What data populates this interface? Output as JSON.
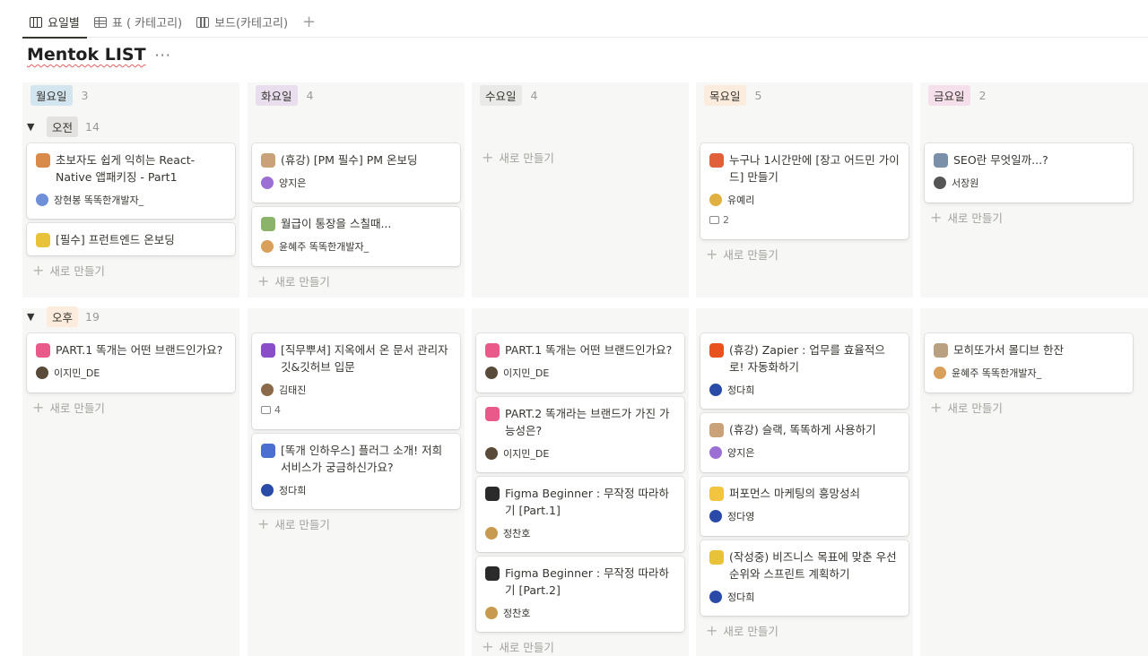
{
  "tabs": [
    {
      "label": "요일별",
      "icon": "board-view-icon"
    },
    {
      "label": "표 ( 카테고리)",
      "icon": "table-view-icon"
    },
    {
      "label": "보드(카테고리)",
      "icon": "board-view-icon"
    }
  ],
  "tab_add": "+",
  "title": "Mentok LIST",
  "more": "···",
  "columns": [
    {
      "label": "월요일",
      "count": "3",
      "color": "#d3e5ef"
    },
    {
      "label": "화요일",
      "count": "4",
      "color": "#e8deee"
    },
    {
      "label": "수요일",
      "count": "4",
      "color": "#e9e9e7"
    },
    {
      "label": "목요일",
      "count": "5",
      "color": "#fbecdd"
    },
    {
      "label": "금요일",
      "count": "2",
      "color": "#f4dfeb"
    }
  ],
  "groups": [
    {
      "label": "오전",
      "count": "14"
    },
    {
      "label": "오후",
      "count": "19"
    }
  ],
  "new_label": "새로 만들기",
  "cards": {
    "am": [
      [
        {
          "title": "초보자도 쉽게 익히는 React-Native 앱패키징 - Part1",
          "person": "장현봉 똑똑한개발자_",
          "emoji": "technologist-emoji",
          "emoji_color": "#d98c4a",
          "avatar_color": "#6f8fd8"
        },
        {
          "title": "[필수] 프런트엔드 온보딩",
          "person": "",
          "emoji": "notebook-emoji",
          "emoji_color": "#e8c33a"
        }
      ],
      [
        {
          "title": "(휴강) [PM 필수] PM 온보딩",
          "person": "양지은",
          "emoji": "monkey-emoji",
          "emoji_color": "#c9a27a",
          "avatar_color": "#9b6fd3"
        },
        {
          "title": "월급이 통장을 스칠때...",
          "person": "윤혜주 똑똑한개발자_",
          "emoji": "money-emoji",
          "emoji_color": "#8bb36a",
          "avatar_color": "#d8a05a"
        }
      ],
      [],
      [
        {
          "title": "누구나 1시간만에 [장고 어드민 가이드] 만들기",
          "person": "유예리",
          "emoji": "fire-emoji",
          "emoji_color": "#e0603a",
          "avatar_color": "#e0b040",
          "comments": "2"
        }
      ],
      [
        {
          "title": "SEO란 무엇일까...?",
          "person": "서장원",
          "emoji": "magnifier-emoji",
          "emoji_color": "#7a8fa8",
          "avatar_color": "#555555"
        }
      ]
    ],
    "pm": [
      [
        {
          "title": "PART.1 똑개는 어떤 브랜드인가요?",
          "person": "이지민_DE",
          "emoji": "heart-emoji",
          "emoji_color": "#e95a8a",
          "avatar_color": "#5a4a3a"
        }
      ],
      [
        {
          "title": "[직무뿌셔] 지옥에서 온 문서 관리자 깃&깃허브 입문",
          "person": "김태진",
          "emoji": "devil-emoji",
          "emoji_color": "#8a4fc8",
          "avatar_color": "#8a6a4a",
          "comments": "4"
        },
        {
          "title": "[똑개 인하우스] 플러그 소개! 저희 서비스가 궁금하신가요?",
          "person": "정다희",
          "emoji": "plug-emoji",
          "emoji_color": "#4a6fd0",
          "avatar_color": "#2a4aa8"
        }
      ],
      [
        {
          "title": "PART.1 똑개는 어떤 브랜드인가요?",
          "person": "이지민_DE",
          "emoji": "heart-emoji",
          "emoji_color": "#e95a8a",
          "avatar_color": "#5a4a3a"
        },
        {
          "title": "PART.2 똑개라는 브랜드가 가진 가능성은?",
          "person": "이지민_DE",
          "emoji": "heart-emoji",
          "emoji_color": "#e95a8a",
          "avatar_color": "#5a4a3a"
        },
        {
          "title": "Figma Beginner : 무작정 따라하기 [Part.1]",
          "person": "정찬호",
          "emoji": "figma-emoji",
          "emoji_color": "#2a2a2a",
          "avatar_color": "#c89a50"
        },
        {
          "title": "Figma Beginner : 무작정 따라하기 [Part.2]",
          "person": "정찬호",
          "emoji": "figma-emoji",
          "emoji_color": "#2a2a2a",
          "avatar_color": "#c89a50"
        }
      ],
      [
        {
          "title": "(휴강) Zapier : 업무를 효율적으로! 자동화하기",
          "person": "정다희",
          "emoji": "zapier-emoji",
          "emoji_color": "#e8521f",
          "avatar_color": "#2a4aa8"
        },
        {
          "title": "(휴강) 슬랙, 똑똑하게 사용하기",
          "person": "양지은",
          "emoji": "monkey-emoji",
          "emoji_color": "#c9a27a",
          "avatar_color": "#9b6fd3"
        },
        {
          "title": "퍼포먼스 마케팅의 흥망성쇠",
          "person": "정다영",
          "emoji": "chick-emoji",
          "emoji_color": "#f2c440",
          "avatar_color": "#2a4aa8"
        },
        {
          "title": "(작성중) 비즈니스 목표에 맞춘 우선순위와 스프린트 계획하기",
          "person": "정다희",
          "emoji": "notebook-emoji",
          "emoji_color": "#e8c33a",
          "avatar_color": "#2a4aa8"
        }
      ],
      [
        {
          "title": "모히또가서 몰디브 한잔",
          "person": "윤혜주 똑똑한개발자_",
          "emoji": "cocktail-emoji",
          "emoji_color": "#b8a080",
          "avatar_color": "#d8a05a"
        }
      ]
    ]
  }
}
